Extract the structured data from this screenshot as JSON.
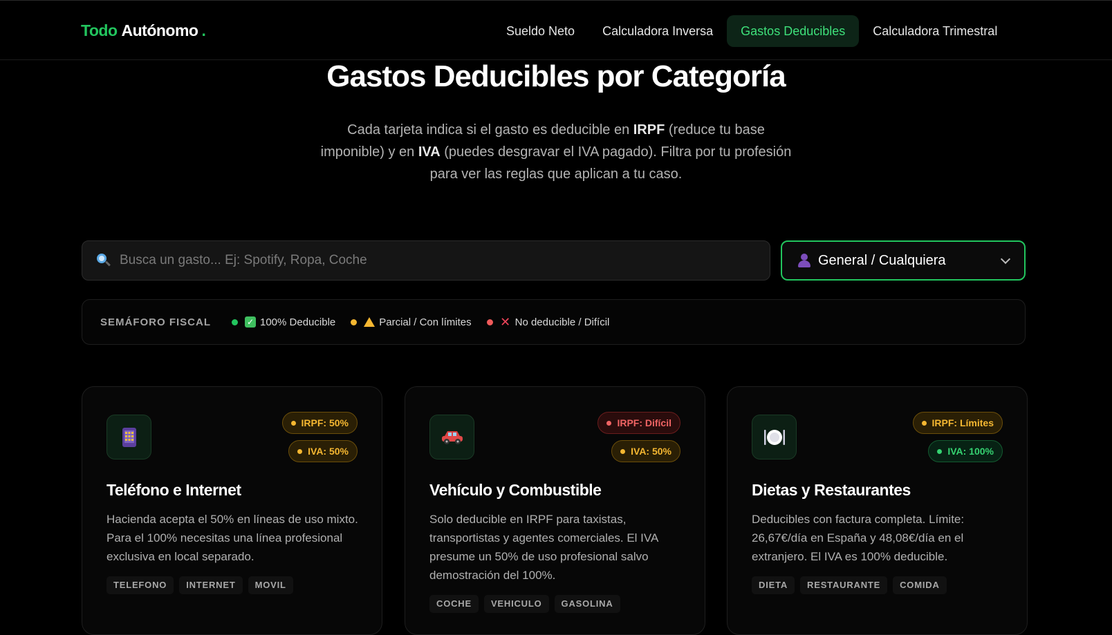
{
  "logo": {
    "part1": "Todo",
    "part2": "Autónomo",
    "part3": "."
  },
  "nav": {
    "items": [
      {
        "label": "Sueldo Neto"
      },
      {
        "label": "Calculadora Inversa"
      },
      {
        "label": "Gastos Deducibles"
      },
      {
        "label": "Calculadora Trimestral"
      }
    ],
    "active_index": 2
  },
  "hero": {
    "title": "Gastos Deducibles por Categoría",
    "sub_a": "Cada tarjeta indica si el gasto es deducible en ",
    "sub_irpf": "IRPF",
    "sub_b": " (reduce tu base imponible) y en ",
    "sub_iva": "IVA",
    "sub_c": " (puedes desgravar el IVA pagado). Filtra por tu profesión para ver las reglas que aplican a tu caso."
  },
  "search": {
    "placeholder": "Busca un gasto... Ej: Spotify, Ropa, Coche",
    "value": "",
    "icon": "search-icon"
  },
  "profession_select": {
    "value": "General / Cualquiera",
    "icon": "person-icon"
  },
  "legend": {
    "title": "SEMÁFORO FISCAL",
    "items": [
      {
        "label": "100% Deducible",
        "color": "#22c55e",
        "icon": "check-icon"
      },
      {
        "label": "Parcial / Con límites",
        "color": "#f5b731",
        "icon": "warning-icon"
      },
      {
        "label": "No deducible / Difícil",
        "color": "#f05a5a",
        "icon": "cross-icon"
      }
    ]
  },
  "cards": [
    {
      "icon": "phone-icon",
      "irpf": "IRPF: 50%",
      "irpf_status": "yellow",
      "iva": "IVA: 50%",
      "iva_status": "yellow",
      "title": "Teléfono e Internet",
      "desc": "Hacienda acepta el 50% en líneas de uso mixto. Para el 100% necesitas una línea profesional exclusiva en local separado.",
      "tags": [
        "TELEFONO",
        "INTERNET",
        "MOVIL"
      ]
    },
    {
      "icon": "car-icon",
      "irpf": "IRPF: Difícil",
      "irpf_status": "red",
      "iva": "IVA: 50%",
      "iva_status": "yellow",
      "title": "Vehículo y Combustible",
      "desc": "Solo deducible en IRPF para taxistas, transportistas y agentes comerciales. El IVA presume un 50% de uso profesional salvo demostración del 100%.",
      "tags": [
        "COCHE",
        "VEHICULO",
        "GASOLINA"
      ]
    },
    {
      "icon": "plate-icon",
      "irpf": "IRPF: Límites",
      "irpf_status": "yellow",
      "iva": "IVA: 100%",
      "iva_status": "green",
      "title": "Dietas y Restaurantes",
      "desc": "Deducibles con factura completa. Límite: 26,67€/día en España y 48,08€/día en el extranjero. El IVA es 100% deducible.",
      "tags": [
        "DIETA",
        "RESTAURANTE",
        "COMIDA"
      ]
    }
  ],
  "colors": {
    "accent": "#22c55e",
    "warning": "#f5b731",
    "danger": "#f05a5a",
    "background": "#000000"
  }
}
